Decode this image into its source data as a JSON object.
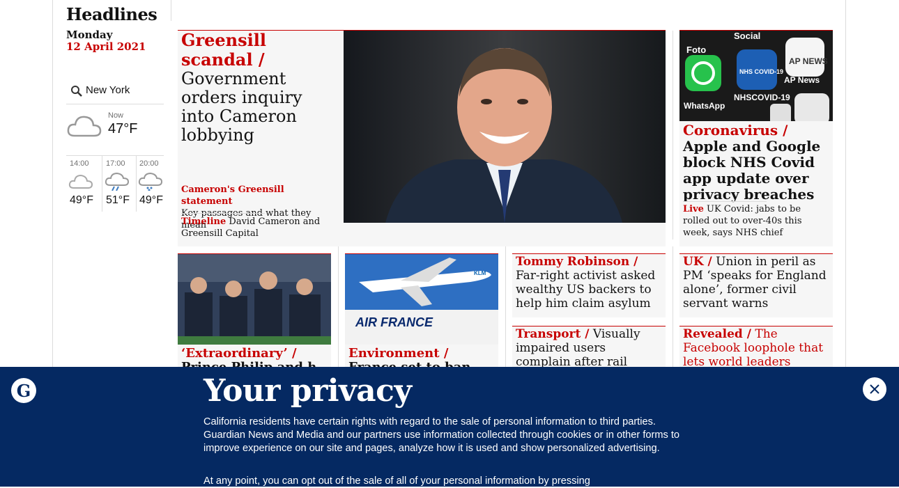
{
  "sidebar": {
    "title": "Headlines",
    "day": "Monday",
    "date": "12 April 2021",
    "location": "New York",
    "now_label": "Now",
    "now_temp": "47°F",
    "forecast": [
      {
        "time": "14:00",
        "temp": "49°F",
        "icon": "cloud-icon"
      },
      {
        "time": "17:00",
        "temp": "51°F",
        "icon": "rain-cloud-icon"
      },
      {
        "time": "20:00",
        "temp": "49°F",
        "icon": "drizzle-cloud-icon"
      }
    ]
  },
  "main_story": {
    "kicker": "Greensill scandal /",
    "headline": "Government orders inquiry into Cameron lobbying",
    "sublinks": [
      {
        "kicker": "Cameron's Greensill statement",
        "text": "Key passages and what they mean"
      },
      {
        "kicker": "Timeline",
        "text": "David Cameron and Greensill Capital"
      }
    ]
  },
  "right_story": {
    "image_labels": [
      "Foto",
      "Social",
      "NHS COVID-19",
      "AP NEWS",
      "WhatsApp",
      "NHSCOVID-19",
      "AP News"
    ],
    "kicker": "Coronavirus /",
    "headline": "Apple and Google block NHS Covid app update over privacy breaches",
    "live_kicker": "Live",
    "live_text": "UK Covid: jabs to be rolled out to over-40s this week, says NHS chief"
  },
  "row2": [
    {
      "kicker": "‘Extraordinary’ /",
      "headline": "Prince Philip and h"
    },
    {
      "kicker": "Environment /",
      "headline": "France set to ban short-haul",
      "image_text": "AIR FRANCE",
      "image_small": "KLM"
    },
    {
      "kicker": "Tommy Robinson /",
      "headline": "Far-right activist asked wealthy US backers to help him claim asylum"
    },
    {
      "kicker": "UK /",
      "headline": "Union in peril as PM ‘speaks for England alone’, former civil servant warns"
    },
    {
      "kicker": "Transport /",
      "headline": "Visually impaired users complain after rail websites go"
    },
    {
      "kicker": "Revealed /",
      "headline": "The Facebook loophole that lets world leaders deceive and harass"
    }
  ],
  "banner": {
    "title": "Your privacy",
    "text1": "California residents have certain rights with regard to the sale of personal information to third parties. Guardian News and Media and our partners use information collected through cookies or in other forms to improve experience on our site and pages, analyze how it is used and show personalized advertising.",
    "text2": "At any point, you can opt out of the sale of all of your personal information by pressing",
    "logo_letter": "G"
  },
  "colors": {
    "brand_red": "#c70000",
    "banner_bg": "#052962"
  }
}
